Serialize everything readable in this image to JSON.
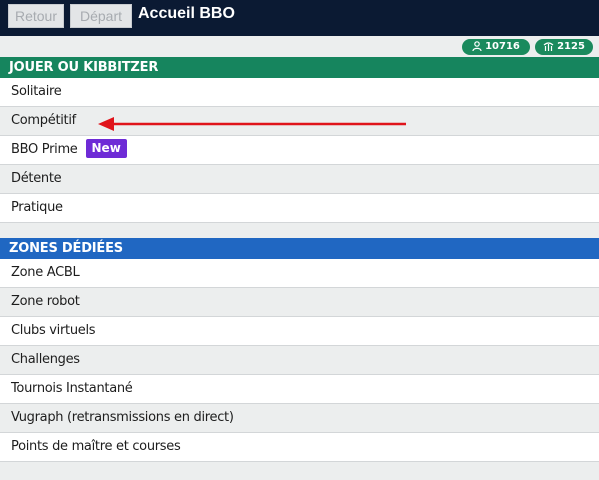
{
  "header": {
    "back_label": "Retour",
    "start_label": "Départ",
    "title": "Accueil BBO"
  },
  "status": {
    "users_count": "10716",
    "tables_count": "2125",
    "users_icon": "user-icon",
    "tables_icon": "table-icon",
    "pill_color": "#1a8a5d"
  },
  "sections": {
    "play": {
      "title": "JOUER OU KIBBITZER",
      "color": "#16855e",
      "items": [
        {
          "label": "Solitaire"
        },
        {
          "label": "Compétitif"
        },
        {
          "label": "BBO Prime",
          "badge": "New"
        },
        {
          "label": "Détente"
        },
        {
          "label": "Pratique"
        }
      ]
    },
    "zones": {
      "title": "ZONES DÉDIÉES",
      "color": "#2067c2",
      "items": [
        {
          "label": "Zone ACBL"
        },
        {
          "label": "Zone robot"
        },
        {
          "label": "Clubs virtuels"
        },
        {
          "label": "Challenges"
        },
        {
          "label": "Tournois Instantané"
        },
        {
          "label": "Vugraph (retransmissions en direct)"
        },
        {
          "label": "Points de maître et courses"
        }
      ]
    }
  },
  "annotation": {
    "arrow_color": "#e0141b",
    "points_to": "Compétitif"
  },
  "badge_color": "#6e2bd6"
}
